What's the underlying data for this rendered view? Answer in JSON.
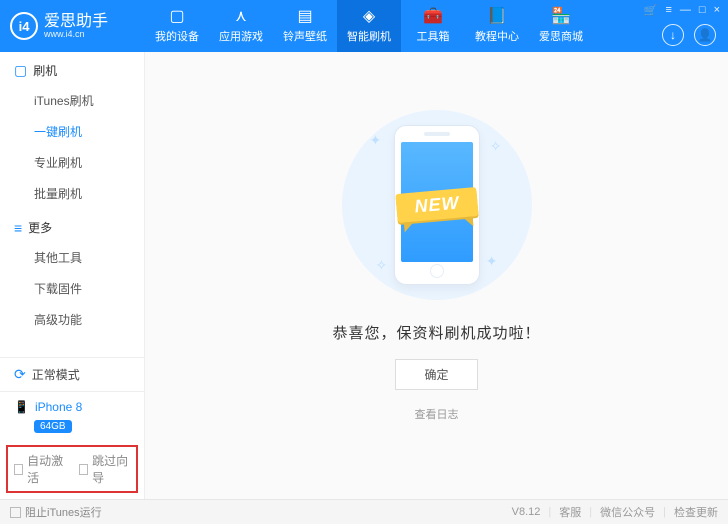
{
  "brand": {
    "name": "爱思助手",
    "sub": "www.i4.cn",
    "logo": "i4"
  },
  "nav": {
    "items": [
      {
        "label": "我的设备",
        "icon": "▢"
      },
      {
        "label": "应用游戏",
        "icon": "⋏"
      },
      {
        "label": "铃声壁纸",
        "icon": "▤"
      },
      {
        "label": "智能刷机",
        "icon": "◈"
      },
      {
        "label": "工具箱",
        "icon": "🧰"
      },
      {
        "label": "教程中心",
        "icon": "📘"
      },
      {
        "label": "爱思商城",
        "icon": "🏪"
      }
    ],
    "active_index": 3
  },
  "win_controls": {
    "cart": "🛒",
    "menu": "≡",
    "min": "—",
    "max": "□",
    "close": "×"
  },
  "header_btns": {
    "download": "↓",
    "user": "👤"
  },
  "sidebar": {
    "group1": {
      "title": "刷机",
      "icon": "▢",
      "items": [
        "iTunes刷机",
        "一键刷机",
        "专业刷机",
        "批量刷机"
      ],
      "active_index": 1
    },
    "group2": {
      "title": "更多",
      "icon": "≡",
      "items": [
        "其他工具",
        "下载固件",
        "高级功能"
      ]
    },
    "mode": {
      "label": "正常模式",
      "icon": "⟳"
    },
    "device": {
      "name": "iPhone 8",
      "storage": "64GB",
      "icon": "📱"
    },
    "options": {
      "auto_activate": "自动激活",
      "skip_guide": "跳过向导"
    }
  },
  "main": {
    "ribbon": "NEW",
    "success": "恭喜您，保资料刷机成功啦！",
    "ok": "确定",
    "view_log": "查看日志"
  },
  "footer": {
    "block_itunes": "阻止iTunes运行",
    "version": "V8.12",
    "support": "客服",
    "wechat": "微信公众号",
    "check_update": "检查更新"
  }
}
